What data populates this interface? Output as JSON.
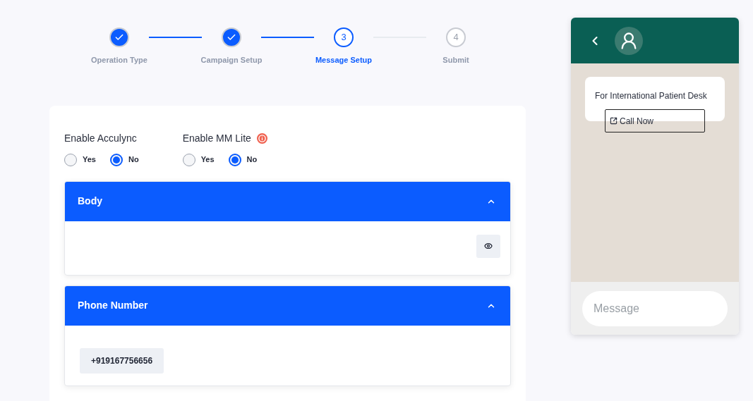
{
  "steps": [
    {
      "label": "Operation Type",
      "completed": true,
      "selected": false
    },
    {
      "label": "Campaign Setup",
      "completed": true,
      "selected": false
    },
    {
      "number": "3",
      "label": "Message Setup",
      "completed": false,
      "selected": true
    },
    {
      "number": "4",
      "label": "Submit",
      "completed": false,
      "selected": false
    }
  ],
  "toggles": [
    {
      "label": "Enable Acculync",
      "info": false,
      "options": [
        {
          "label": "Yes",
          "selected": false
        },
        {
          "label": "No",
          "selected": true
        }
      ]
    },
    {
      "label": "Enable MM Lite",
      "info": true,
      "options": [
        {
          "label": "Yes",
          "selected": false
        },
        {
          "label": "No",
          "selected": true
        }
      ]
    }
  ],
  "sections": [
    {
      "kind": "preview",
      "title": "Body",
      "expanded": true
    },
    {
      "kind": "value",
      "title": "Phone Number",
      "expanded": true,
      "value": "+919167756656"
    }
  ],
  "preview": {
    "message": "For International Patient Desk",
    "button": "Call Now",
    "placeholder": "Message"
  }
}
